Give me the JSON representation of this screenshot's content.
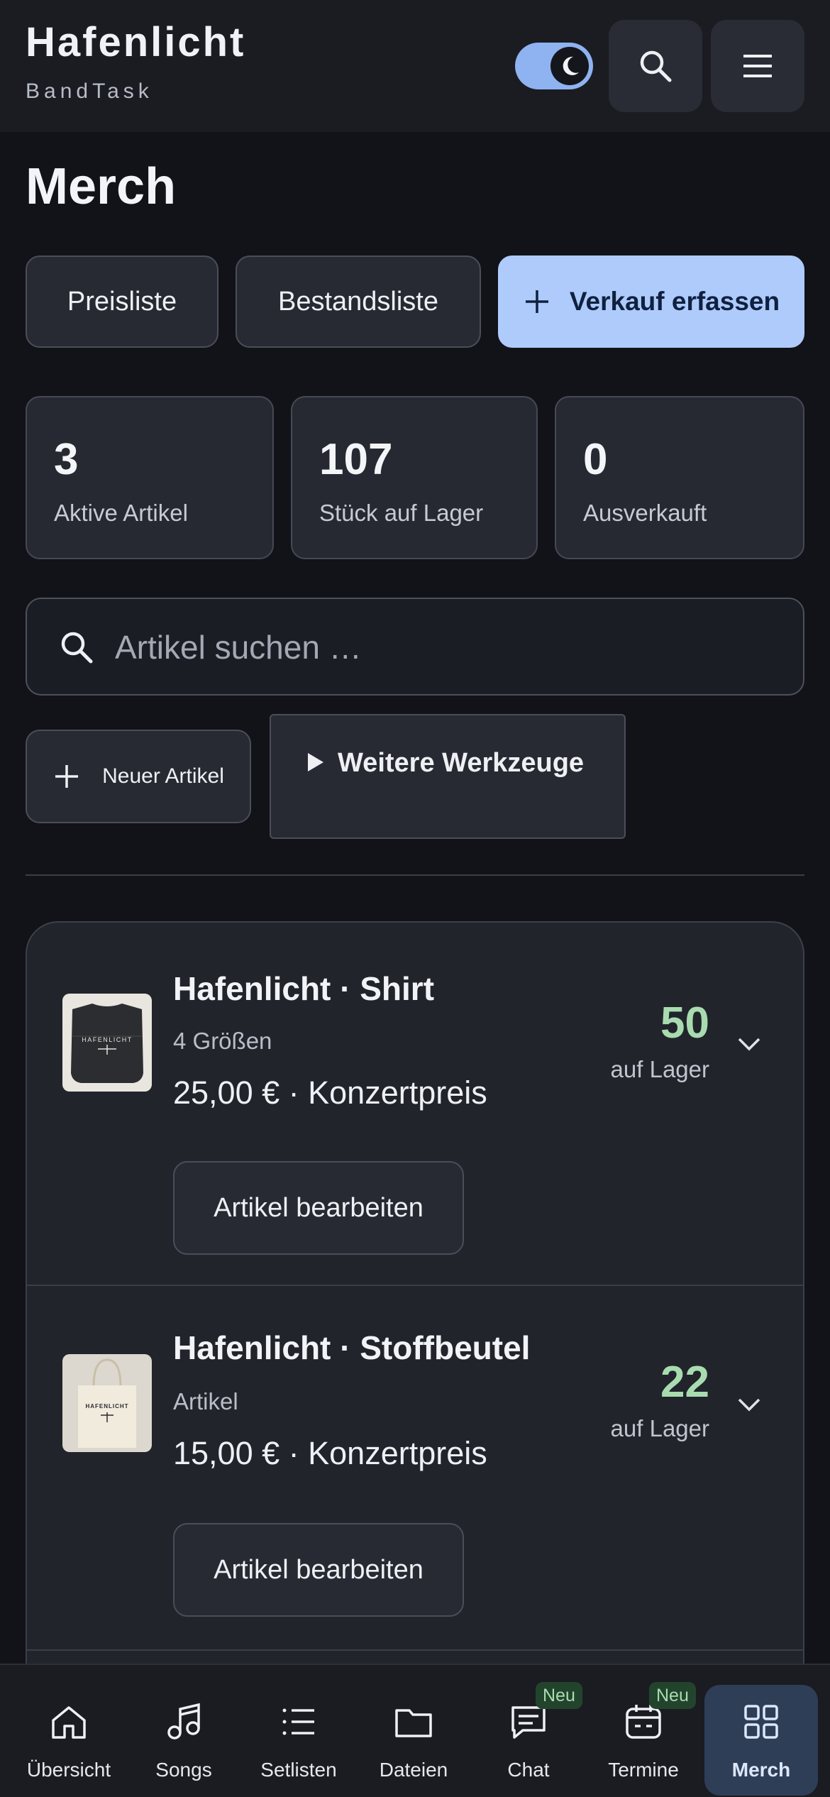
{
  "header": {
    "title": "Hafenlicht",
    "subtitle": "BandTask",
    "theme_toggle": "dark",
    "icons": [
      "moon-icon",
      "search-icon",
      "menu-icon"
    ]
  },
  "page": {
    "title": "Merch"
  },
  "actions": {
    "price_list": "Preisliste",
    "inventory_list": "Bestandsliste",
    "record_sale": "Verkauf erfassen"
  },
  "stats": [
    {
      "value": "3",
      "label": "Aktive Artikel"
    },
    {
      "value": "107",
      "label": "Stück auf Lager"
    },
    {
      "value": "0",
      "label": "Ausverkauft"
    }
  ],
  "search": {
    "placeholder": "Artikel suchen …"
  },
  "tools": {
    "new_item": "Neuer Artikel",
    "more_tools": "Weitere Werkzeuge"
  },
  "items": [
    {
      "name": "Hafenlicht · Shirt",
      "sub": "4 Größen",
      "price": "25,00 € · Konzertpreis",
      "stock": "50",
      "stock_label": "auf Lager",
      "edit": "Artikel bearbeiten",
      "thumb_text": "HAFENLICHT"
    },
    {
      "name": "Hafenlicht · Stoffbeutel",
      "sub": "Artikel",
      "price": "15,00 € · Konzertpreis",
      "stock": "22",
      "stock_label": "auf Lager",
      "edit": "Artikel bearbeiten",
      "thumb_text": "HAFENLICHT"
    }
  ],
  "nav": [
    {
      "label": "Übersicht",
      "icon": "home-icon"
    },
    {
      "label": "Songs",
      "icon": "music-note-icon"
    },
    {
      "label": "Setlisten",
      "icon": "list-icon"
    },
    {
      "label": "Dateien",
      "icon": "folder-icon"
    },
    {
      "label": "Chat",
      "icon": "chat-icon",
      "badge": "Neu"
    },
    {
      "label": "Termine",
      "icon": "calendar-icon",
      "badge": "Neu"
    },
    {
      "label": "Merch",
      "icon": "grid-icon",
      "active": true
    }
  ],
  "colors": {
    "background": "#121318",
    "accent": "#aecbfb",
    "stock_green": "#a8dcb0",
    "active_nav": "#2f3e57"
  }
}
